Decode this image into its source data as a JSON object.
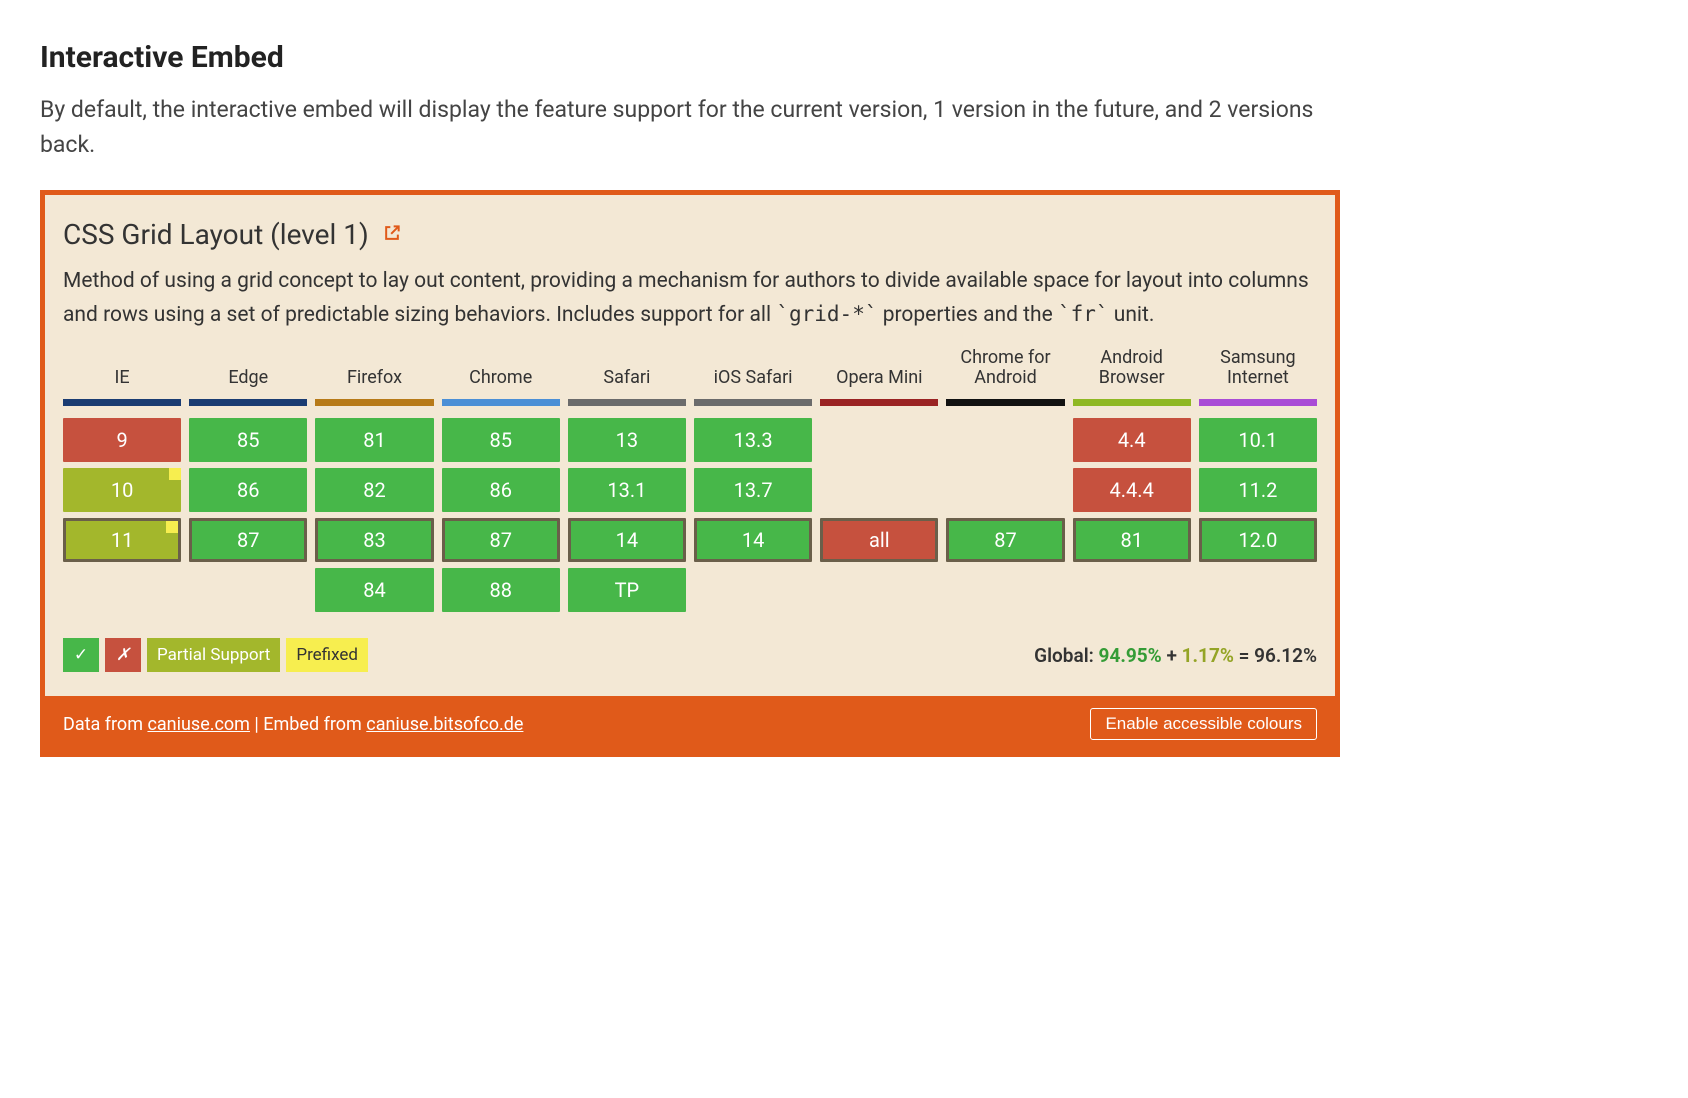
{
  "section": {
    "heading": "Interactive Embed",
    "description": "By default, the interactive embed will display the feature support for the current version, 1 version in the future, and 2 versions back."
  },
  "feature": {
    "title": "CSS Grid Layout (level 1)",
    "description_pre": "Method of using a grid concept to lay out content, providing a mechanism for authors to divide available space for layout into columns and rows using a set of predictable sizing behaviors. Includes support for all ",
    "code1": "`grid-*`",
    "description_mid": " properties and the ",
    "code2": "`fr`",
    "description_post": " unit."
  },
  "browsers": [
    {
      "name": "IE",
      "stripe": "#1a3c72"
    },
    {
      "name": "Edge",
      "stripe": "#1a3c72"
    },
    {
      "name": "Firefox",
      "stripe": "#b77a18"
    },
    {
      "name": "Chrome",
      "stripe": "#4b8fd6"
    },
    {
      "name": "Safari",
      "stripe": "#6b6b6b"
    },
    {
      "name": "iOS Safari",
      "stripe": "#6b6b6b"
    },
    {
      "name": "Opera Mini",
      "stripe": "#9a2323"
    },
    {
      "name": "Chrome for Android",
      "stripe": "#111"
    },
    {
      "name": "Android Browser",
      "stripe": "#8fb824"
    },
    {
      "name": "Samsung Internet",
      "stripe": "#a94bd6"
    }
  ],
  "rows": [
    {
      "current": false,
      "cells": [
        {
          "label": "9",
          "status": "unsupported"
        },
        {
          "label": "85",
          "status": "supported"
        },
        {
          "label": "81",
          "status": "supported"
        },
        {
          "label": "85",
          "status": "supported"
        },
        {
          "label": "13",
          "status": "supported"
        },
        {
          "label": "13.3",
          "status": "supported"
        },
        {
          "label": "",
          "status": "empty"
        },
        {
          "label": "",
          "status": "empty"
        },
        {
          "label": "4.4",
          "status": "unsupported"
        },
        {
          "label": "10.1",
          "status": "supported"
        }
      ]
    },
    {
      "current": false,
      "cells": [
        {
          "label": "10",
          "status": "partial",
          "prefixed": true
        },
        {
          "label": "86",
          "status": "supported"
        },
        {
          "label": "82",
          "status": "supported"
        },
        {
          "label": "86",
          "status": "supported"
        },
        {
          "label": "13.1",
          "status": "supported"
        },
        {
          "label": "13.7",
          "status": "supported"
        },
        {
          "label": "",
          "status": "empty"
        },
        {
          "label": "",
          "status": "empty"
        },
        {
          "label": "4.4.4",
          "status": "unsupported"
        },
        {
          "label": "11.2",
          "status": "supported"
        }
      ]
    },
    {
      "current": true,
      "cells": [
        {
          "label": "11",
          "status": "partial",
          "prefixed": true
        },
        {
          "label": "87",
          "status": "supported"
        },
        {
          "label": "83",
          "status": "supported"
        },
        {
          "label": "87",
          "status": "supported"
        },
        {
          "label": "14",
          "status": "supported"
        },
        {
          "label": "14",
          "status": "supported"
        },
        {
          "label": "all",
          "status": "unsupported"
        },
        {
          "label": "87",
          "status": "supported"
        },
        {
          "label": "81",
          "status": "supported"
        },
        {
          "label": "12.0",
          "status": "supported"
        }
      ]
    },
    {
      "current": false,
      "cells": [
        {
          "label": "",
          "status": "empty"
        },
        {
          "label": "",
          "status": "empty"
        },
        {
          "label": "84",
          "status": "supported"
        },
        {
          "label": "88",
          "status": "supported"
        },
        {
          "label": "TP",
          "status": "supported"
        },
        {
          "label": "",
          "status": "empty"
        },
        {
          "label": "",
          "status": "empty"
        },
        {
          "label": "",
          "status": "empty"
        },
        {
          "label": "",
          "status": "empty"
        },
        {
          "label": "",
          "status": "empty"
        }
      ]
    }
  ],
  "legend": {
    "check": "✓",
    "x": "✗",
    "partial": "Partial Support",
    "prefixed": "Prefixed"
  },
  "global": {
    "label": "Global:",
    "supported": "94.95%",
    "plus": "+",
    "partial": "1.17%",
    "equals": "= 96.12%"
  },
  "footer": {
    "prefix": "Data from ",
    "link1": "caniuse.com",
    "sep": " | Embed from ",
    "link2": "caniuse.bitsofco.de",
    "button": "Enable accessible colours"
  }
}
